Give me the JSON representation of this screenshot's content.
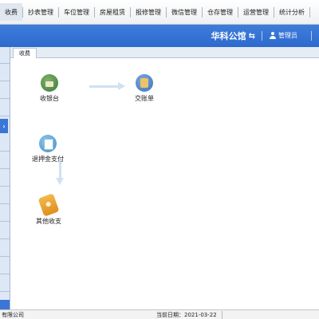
{
  "menu": {
    "items": [
      {
        "label": "收费",
        "active": true
      },
      {
        "label": "抄表管理"
      },
      {
        "label": "车位管理"
      },
      {
        "label": "房屋租赁"
      },
      {
        "label": "报修管理"
      },
      {
        "label": "微信管理"
      },
      {
        "label": "仓存管理"
      },
      {
        "label": "运营管理"
      },
      {
        "label": "统计分析"
      }
    ]
  },
  "header": {
    "brand": "华科公馆",
    "brand_switch_icon": "swap-icon",
    "user": "管理员",
    "user_icon": "user-icon",
    "background_color": "#3575d8"
  },
  "sidebar": {
    "toggle_icon": "expand-chevron-icon",
    "accent_color": "#3a76d6"
  },
  "tabs": [
    {
      "label": "收费"
    }
  ],
  "workflow": {
    "nodes": [
      {
        "label": "收银台",
        "icon": "cashier-icon"
      },
      {
        "label": "交账单",
        "icon": "statement-icon"
      },
      {
        "label": "退押金支付",
        "icon": "deposit-refund-icon"
      },
      {
        "label": "其他收支",
        "icon": "other-income-icon"
      }
    ],
    "connectors": [
      {
        "from": "收银台",
        "to": "交账单",
        "direction": "right"
      },
      {
        "from": "收银台",
        "to": "退押金支付",
        "direction": "down"
      }
    ],
    "arrow_color": "#cfe1f2"
  },
  "statusbar": {
    "company": "有限公司",
    "date": "当前日期：2021-03-22"
  }
}
